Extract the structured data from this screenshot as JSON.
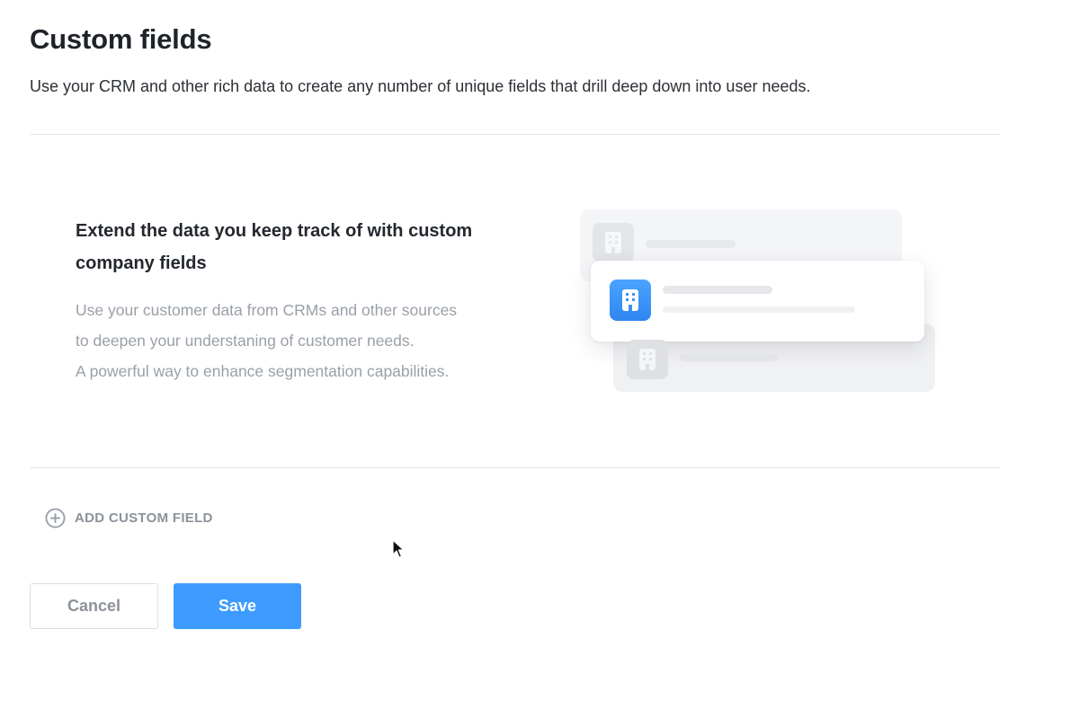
{
  "header": {
    "title": "Custom fields",
    "subtitle": "Use your CRM and other rich data to create any number of unique fields that drill deep down into user needs."
  },
  "empty_state": {
    "heading": "Extend the data you keep track of with custom company fields",
    "description_lines": [
      "Use your customer data from CRMs and other sources",
      "to deepen your understaning of customer needs.",
      "A powerful way to enhance segmentation capabilities."
    ],
    "illustration_icons": [
      "building-icon",
      "building-icon",
      "building-icon"
    ]
  },
  "actions": {
    "add_field_label": "ADD CUSTOM FIELD",
    "add_field_icon": "plus-circle-icon",
    "cancel_label": "Cancel",
    "save_label": "Save"
  },
  "colors": {
    "primary": "#3d9bff",
    "muted_text": "#9aa0a8",
    "divider": "#e3e5e8"
  }
}
